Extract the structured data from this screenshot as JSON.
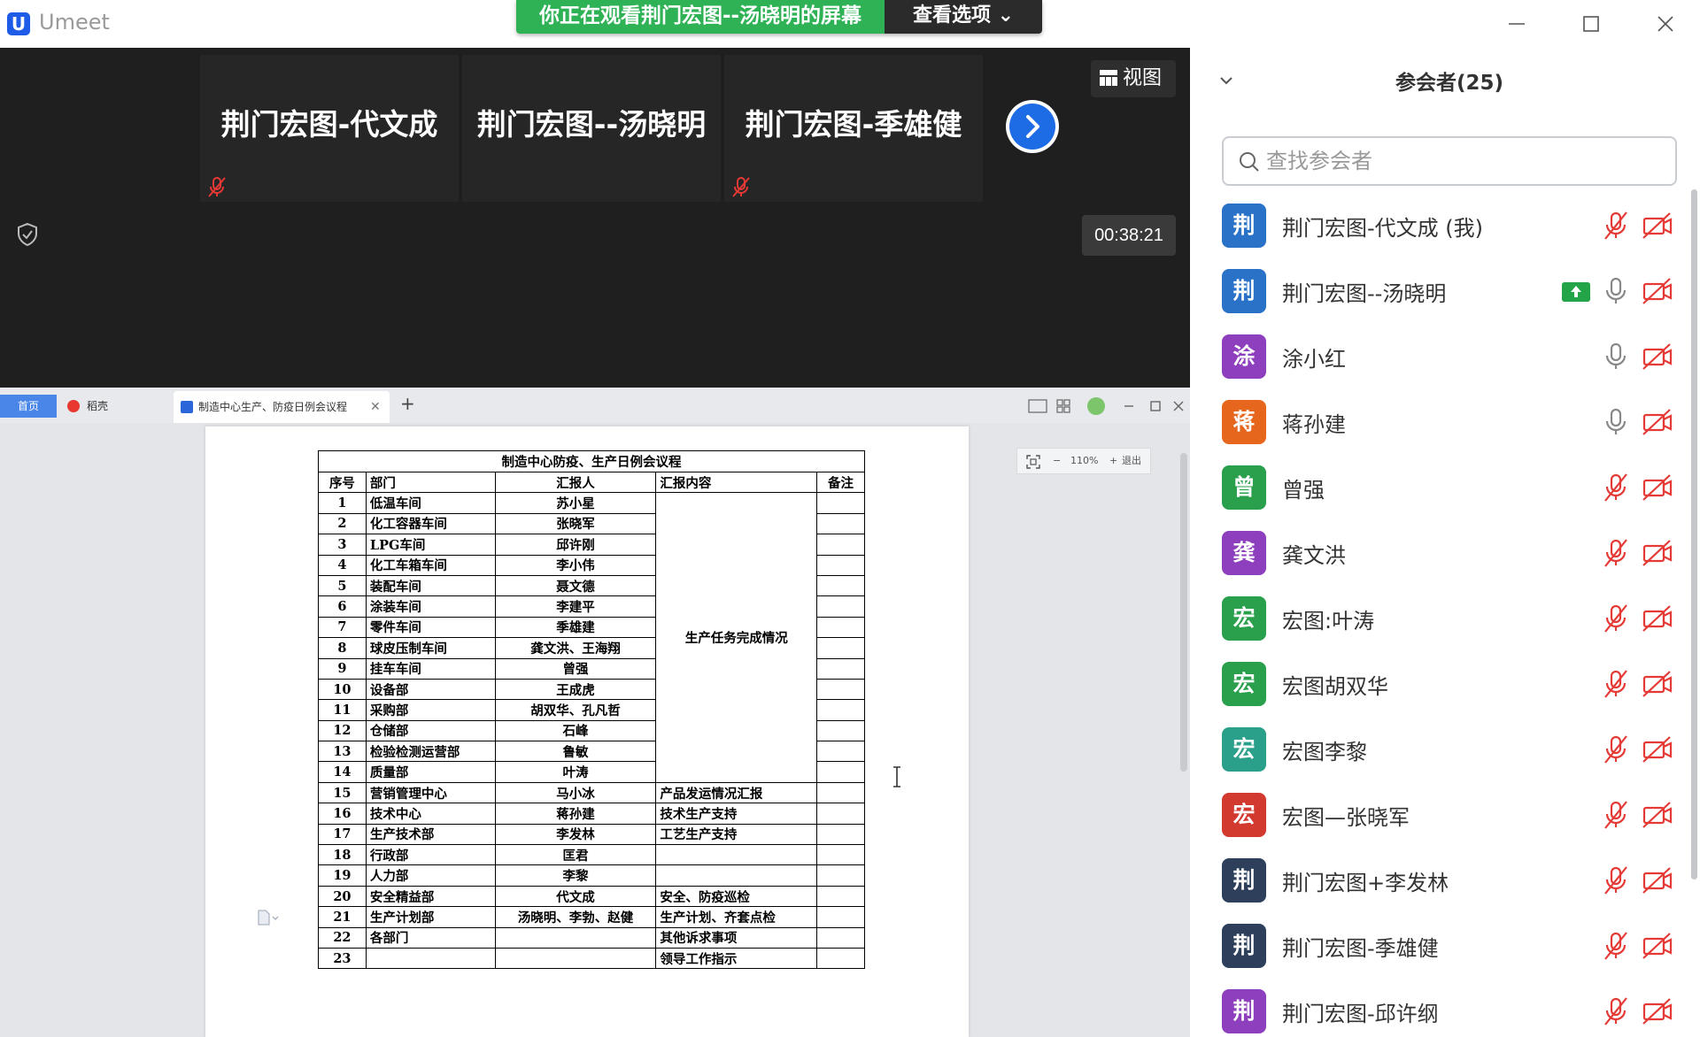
{
  "app": {
    "name": "Umeet",
    "logo_letter": "U"
  },
  "share_banner": {
    "message": "你正在观看荆门宏图--汤晓明的屏幕",
    "options_label": "查看选项 ⌄"
  },
  "video": {
    "tiles": [
      {
        "name": "荆门宏图-代文成",
        "muted": true
      },
      {
        "name": "荆门宏图--汤晓明",
        "muted": false
      },
      {
        "name": "荆门宏图-季雄健",
        "muted": true
      }
    ],
    "view_button": "视图",
    "timer": "00:38:21"
  },
  "shared_screen": {
    "tabs": {
      "home": "首页",
      "daoke": "稻壳",
      "document": "制造中心生产、防疫日例会议程"
    },
    "zoom": {
      "level": "110%",
      "exit": "退出",
      "minus": "−",
      "plus": "+"
    },
    "table": {
      "title": "制造中心防疫、生产日例会议程",
      "headers": [
        "序号",
        "部门",
        "汇报人",
        "汇报内容",
        "备注"
      ],
      "merged_content": "生产任务完成情况",
      "rows": [
        [
          "1",
          "低温车间",
          "苏小星",
          ""
        ],
        [
          "2",
          "化工容器车间",
          "张晓军",
          ""
        ],
        [
          "3",
          "LPG车间",
          "邱许刚",
          ""
        ],
        [
          "4",
          "化工车箱车间",
          "李小伟",
          ""
        ],
        [
          "5",
          "装配车间",
          "聂文德",
          ""
        ],
        [
          "6",
          "涂装车间",
          "李建平",
          ""
        ],
        [
          "7",
          "零件车间",
          "季雄建",
          ""
        ],
        [
          "8",
          "球皮压制车间",
          "龚文洪、王海翔",
          ""
        ],
        [
          "9",
          "挂车车间",
          "曾强",
          ""
        ],
        [
          "10",
          "设备部",
          "王成虎",
          ""
        ],
        [
          "11",
          "采购部",
          "胡双华、孔凡哲",
          ""
        ],
        [
          "12",
          "仓储部",
          "石峰",
          ""
        ],
        [
          "13",
          "检验检测运营部",
          "鲁敏",
          ""
        ],
        [
          "14",
          "质量部",
          "叶涛",
          ""
        ],
        [
          "15",
          "营销管理中心",
          "马小冰",
          "产品发运情况汇报"
        ],
        [
          "16",
          "技术中心",
          "蒋孙建",
          "技术生产支持"
        ],
        [
          "17",
          "生产技术部",
          "李发林",
          "工艺生产支持"
        ],
        [
          "18",
          "行政部",
          "匡君",
          ""
        ],
        [
          "19",
          "人力部",
          "李黎",
          ""
        ],
        [
          "20",
          "安全精益部",
          "代文成",
          "安全、防疫巡检"
        ],
        [
          "21",
          "生产计划部",
          "汤晓明、李勃、赵健",
          "生产计划、齐套点检"
        ],
        [
          "22",
          "各部门",
          "",
          "其他诉求事项"
        ],
        [
          "23",
          "",
          "",
          "领导工作指示"
        ]
      ]
    }
  },
  "participants": {
    "title": "参会者(25)",
    "search_placeholder": "查找参会者",
    "list": [
      {
        "avatar": "荆",
        "color": "#2a72c8",
        "name": "荆门宏图-代文成 (我)",
        "mic": "muted",
        "sharing": false
      },
      {
        "avatar": "荆",
        "color": "#2a72c8",
        "name": "荆门宏图--汤晓明",
        "mic": "on",
        "sharing": true
      },
      {
        "avatar": "涂",
        "color": "#8e3fbd",
        "name": "涂小红",
        "mic": "on",
        "sharing": false
      },
      {
        "avatar": "蒋",
        "color": "#e5661c",
        "name": "蒋孙建",
        "mic": "on",
        "sharing": false
      },
      {
        "avatar": "曾",
        "color": "#2aa04d",
        "name": "曾强",
        "mic": "muted",
        "sharing": false
      },
      {
        "avatar": "龚",
        "color": "#8e3fbd",
        "name": "龚文洪",
        "mic": "muted",
        "sharing": false
      },
      {
        "avatar": "宏",
        "color": "#2aa04d",
        "name": "宏图:叶涛",
        "mic": "muted",
        "sharing": false
      },
      {
        "avatar": "宏",
        "color": "#2aa04d",
        "name": "宏图胡双华",
        "mic": "muted",
        "sharing": false
      },
      {
        "avatar": "宏",
        "color": "#2aa08a",
        "name": "宏图李黎",
        "mic": "muted",
        "sharing": false
      },
      {
        "avatar": "宏",
        "color": "#d23a30",
        "name": "宏图—张晓军",
        "mic": "muted",
        "sharing": false
      },
      {
        "avatar": "荆",
        "color": "#2d3f5a",
        "name": "荆门宏图+李发林",
        "mic": "muted",
        "sharing": false
      },
      {
        "avatar": "荆",
        "color": "#2d3f5a",
        "name": "荆门宏图-季雄健",
        "mic": "muted",
        "sharing": false
      },
      {
        "avatar": "荆",
        "color": "#8e3fbd",
        "name": "荆门宏图-邱许纲",
        "mic": "muted",
        "sharing": false
      }
    ]
  }
}
